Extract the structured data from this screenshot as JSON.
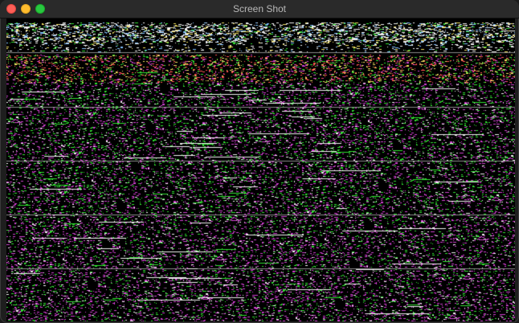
{
  "window": {
    "title": "Screen Shot"
  },
  "image": {
    "description_name": "glitched-memory-dump-image"
  },
  "colors": {
    "background": "#000000",
    "noise_magenta": "#d040d0",
    "noise_green": "#30e030",
    "noise_white": "#f0f0f0",
    "noise_cyan": "#80c0ff",
    "noise_yellow": "#f0e060",
    "noise_red": "#ff5050"
  }
}
